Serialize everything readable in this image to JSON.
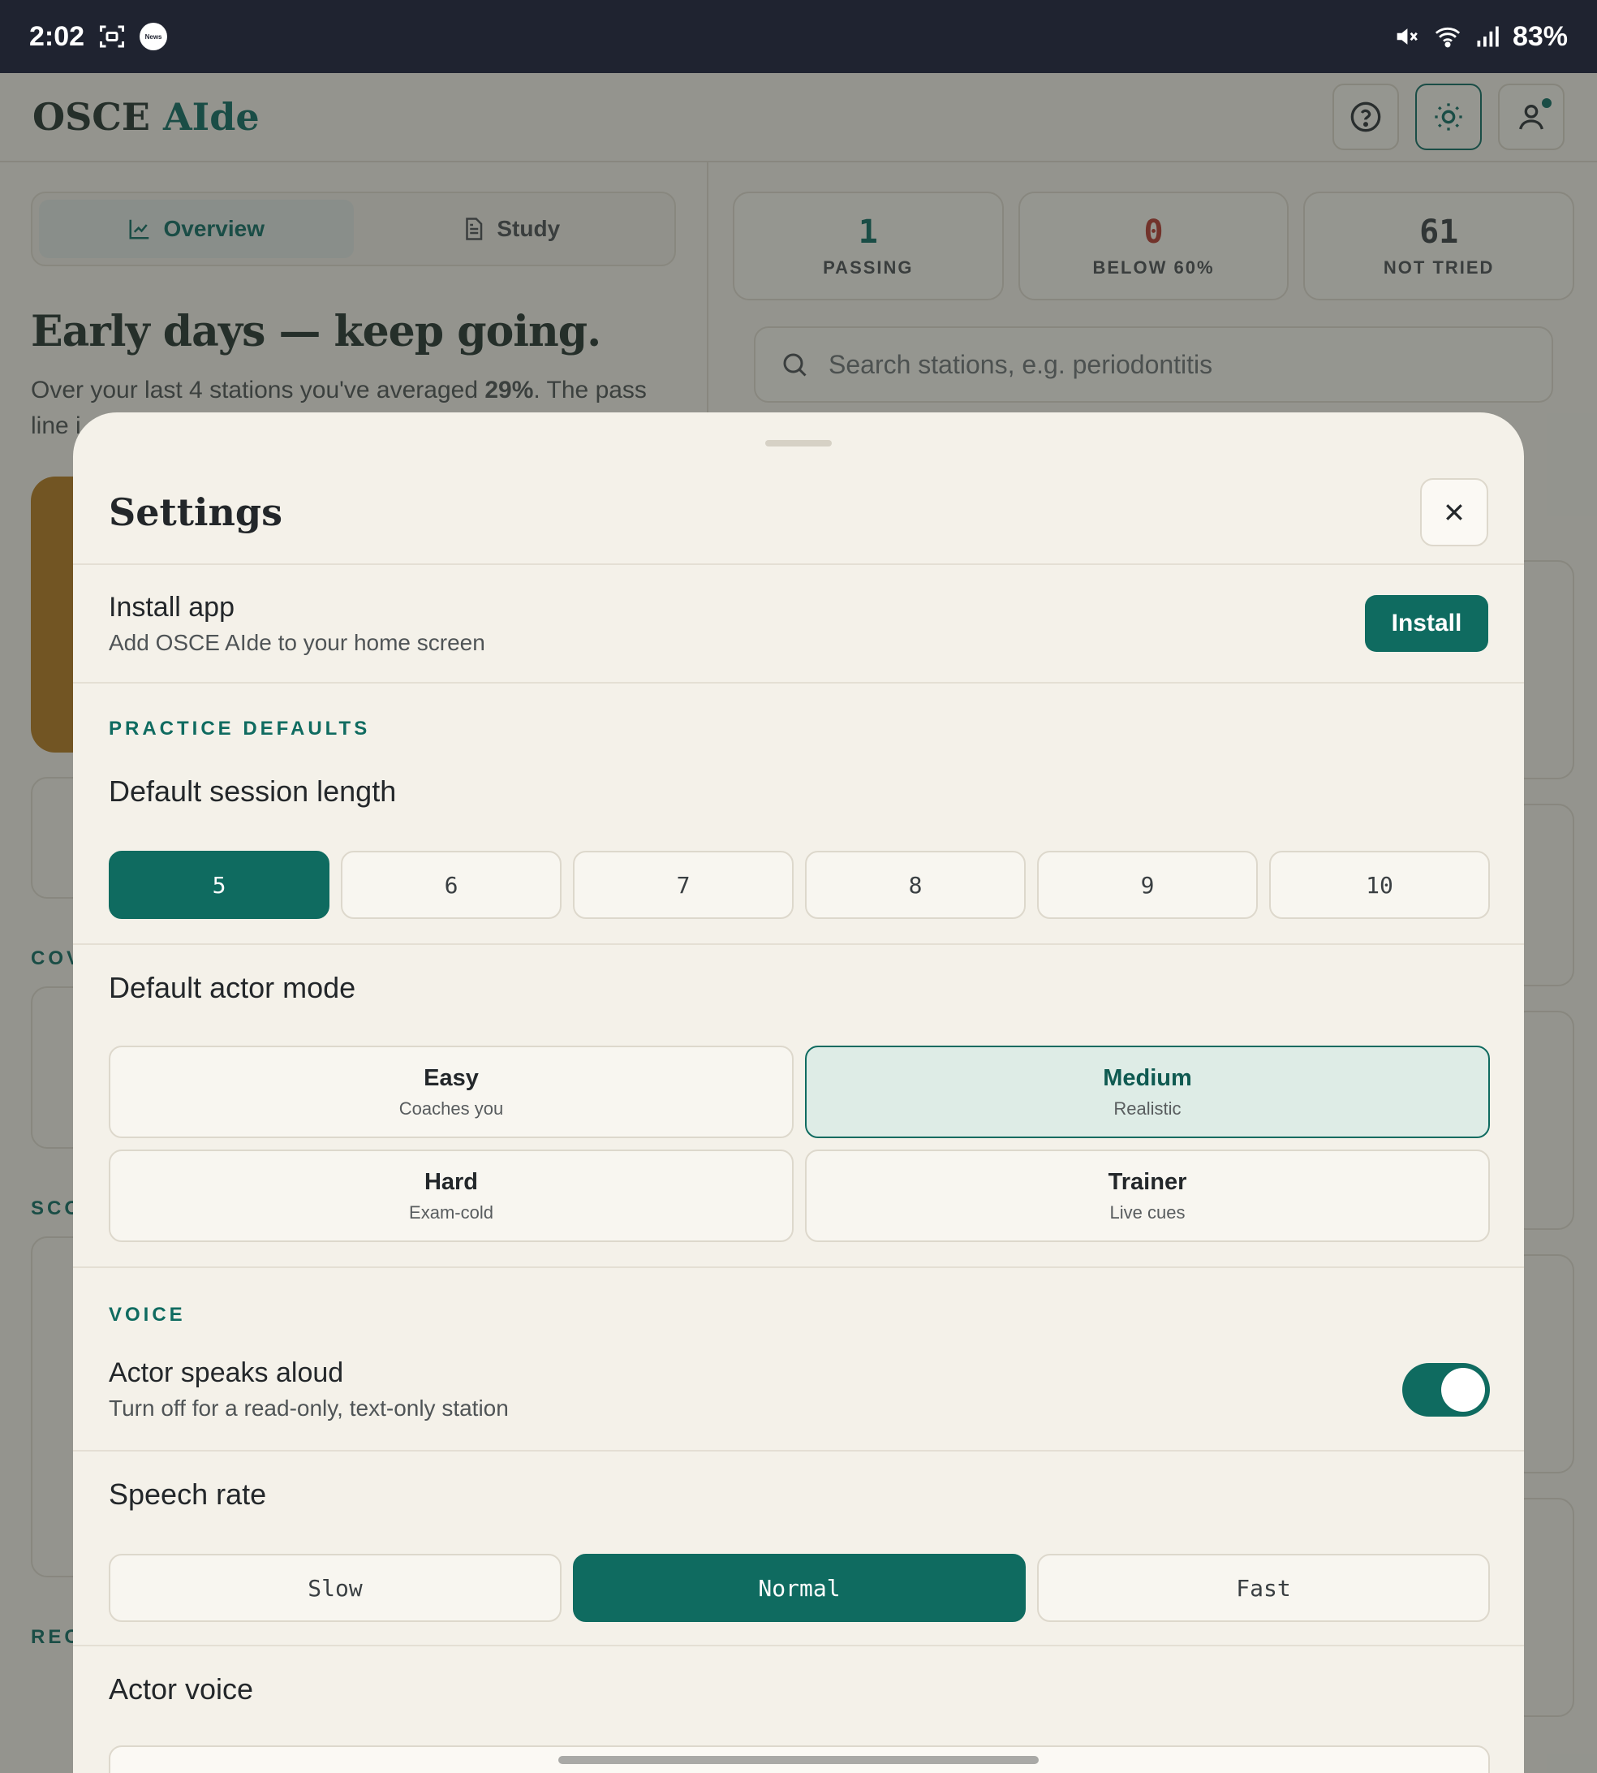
{
  "status_bar": {
    "time": "2:02",
    "battery": "83%",
    "news_label": "News"
  },
  "app": {
    "logo_prefix": "OSCE ",
    "logo_ai": "AIde",
    "tabs": [
      {
        "label": "Overview",
        "active": true
      },
      {
        "label": "Study",
        "active": false
      }
    ],
    "headline": "Early days — keep going.",
    "subline_start": "Over your last 4 stations you've averaged ",
    "subline_value": "29%",
    "subline_end": ". The pass line i",
    "section_labels": [
      "COV",
      "SCO",
      "REC"
    ],
    "stats": [
      {
        "value": "1",
        "label": "PASSING"
      },
      {
        "value": "0",
        "label": "BELOW 60%"
      },
      {
        "value": "61",
        "label": "NOT TRIED"
      }
    ],
    "search_placeholder": "Search stations, e.g. periodontitis"
  },
  "settings": {
    "title": "Settings",
    "install": {
      "title": "Install app",
      "subtitle": "Add OSCE AIde to your home screen",
      "button": "Install"
    },
    "practice_section": "PRACTICE DEFAULTS",
    "session_length": {
      "label": "Default session length",
      "options": [
        "5",
        "6",
        "7",
        "8",
        "9",
        "10"
      ],
      "selected": "5"
    },
    "actor_mode": {
      "label": "Default actor mode",
      "options": [
        {
          "name": "Easy",
          "desc": "Coaches you"
        },
        {
          "name": "Medium",
          "desc": "Realistic"
        },
        {
          "name": "Hard",
          "desc": "Exam-cold"
        },
        {
          "name": "Trainer",
          "desc": "Live cues"
        }
      ],
      "selected": "Medium"
    },
    "voice_section": "VOICE",
    "speaks_aloud": {
      "title": "Actor speaks aloud",
      "subtitle": "Turn off for a read-only, text-only station",
      "enabled": true
    },
    "speech_rate": {
      "label": "Speech rate",
      "options": [
        "Slow",
        "Normal",
        "Fast"
      ],
      "selected": "Normal"
    },
    "actor_voice": {
      "label": "Actor voice"
    }
  },
  "colors": {
    "accent": "#0f6b60",
    "danger": "#b43a2e",
    "warning_card": "#b47a1f"
  }
}
